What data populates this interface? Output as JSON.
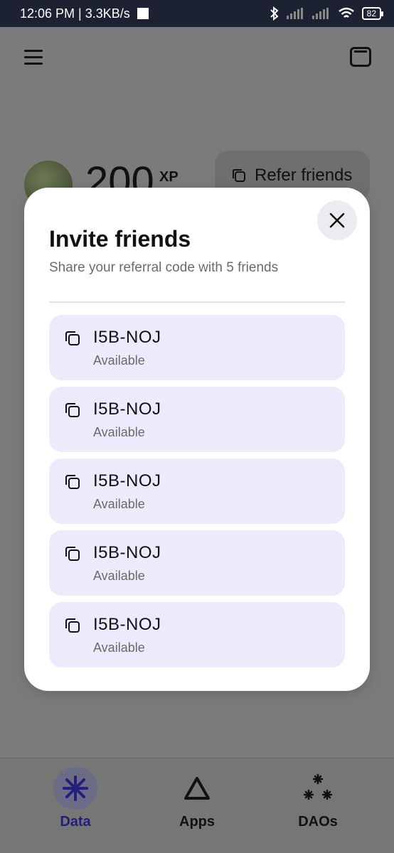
{
  "status_bar": {
    "time_speed": "12:06 PM | 3.3KB/s",
    "battery": "82"
  },
  "header": {
    "menu_icon": "hamburger-icon",
    "wallet_icon": "wallet-icon"
  },
  "profile": {
    "xp_value": "200",
    "xp_unit": "XP",
    "refer_label": "Refer friends"
  },
  "modal": {
    "title": "Invite friends",
    "subtitle": "Share your referral code with 5 friends",
    "codes": [
      {
        "code": "I5B-NOJ",
        "status": "Available"
      },
      {
        "code": "I5B-NOJ",
        "status": "Available"
      },
      {
        "code": "I5B-NOJ",
        "status": "Available"
      },
      {
        "code": "I5B-NOJ",
        "status": "Available"
      },
      {
        "code": "I5B-NOJ",
        "status": "Available"
      }
    ]
  },
  "bottom_nav": {
    "items": [
      {
        "label": "Data",
        "icon": "asterisk-icon",
        "active": true
      },
      {
        "label": "Apps",
        "icon": "triangle-icon",
        "active": false
      },
      {
        "label": "DAOs",
        "icon": "cluster-icon",
        "active": false
      }
    ]
  },
  "colors": {
    "accent": "#231f7a",
    "card_bg": "#ebebfb",
    "statusbar_bg": "#1d2233"
  }
}
